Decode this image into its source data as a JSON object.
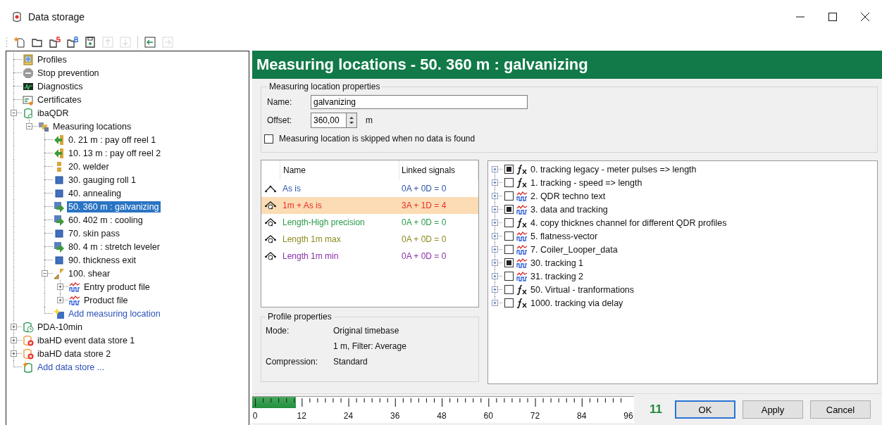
{
  "window": {
    "title": "Data storage"
  },
  "toolbar": [
    {
      "kind": "new",
      "disabled": false
    },
    {
      "kind": "open",
      "disabled": false
    },
    {
      "kind": "open-s",
      "disabled": false
    },
    {
      "kind": "open-b",
      "disabled": false
    },
    {
      "kind": "save",
      "disabled": false
    },
    {
      "kind": "up",
      "disabled": true
    },
    {
      "kind": "down",
      "disabled": true
    },
    {
      "kind": "back",
      "disabled": false
    },
    {
      "kind": "forward",
      "disabled": true
    }
  ],
  "tree": [
    {
      "label": "Profiles",
      "kind": "profiles",
      "selected": false
    },
    {
      "label": "Stop prevention",
      "kind": "stop",
      "selected": false
    },
    {
      "label": "Diagnostics",
      "kind": "diagnostics",
      "selected": false
    },
    {
      "label": "Certificates",
      "kind": "certificates",
      "selected": false
    },
    {
      "label": "ibaQDR",
      "kind": "store",
      "selected": false,
      "expanded": true,
      "children": [
        {
          "label": "Measuring locations",
          "kind": "locations",
          "selected": false,
          "expanded": true,
          "children": [
            {
              "label": "0. 21 m : pay off reel 1",
              "kind": "entry",
              "selected": false
            },
            {
              "label": "10. 13 m : pay off reel 2",
              "kind": "entry",
              "selected": false
            },
            {
              "label": "20. welder",
              "kind": "joint",
              "selected": false
            },
            {
              "label": "30. gauging roll 1",
              "kind": "station",
              "selected": false
            },
            {
              "label": "40. annealing",
              "kind": "station",
              "selected": false
            },
            {
              "label": "50. 360 m : galvanizing",
              "kind": "exit",
              "selected": true
            },
            {
              "label": "60. 402 m : cooling",
              "kind": "exit",
              "selected": false
            },
            {
              "label": "70. skin pass",
              "kind": "station",
              "selected": false
            },
            {
              "label": "80. 4 m : stretch leveler",
              "kind": "exit",
              "selected": false
            },
            {
              "label": "90. thickness exit",
              "kind": "station",
              "selected": false
            },
            {
              "label": "100. shear",
              "kind": "shear",
              "selected": false,
              "expanded": true,
              "children": [
                {
                  "label": "Entry product file",
                  "kind": "file",
                  "selected": false,
                  "expanded": false
                },
                {
                  "label": "Product file",
                  "kind": "file",
                  "selected": false,
                  "expanded": false
                }
              ]
            },
            {
              "label": "Add measuring location",
              "kind": "add",
              "selected": false,
              "link": true
            }
          ]
        }
      ]
    },
    {
      "label": "PDA-10min",
      "kind": "timed",
      "selected": false,
      "expanded": false
    },
    {
      "label": "ibaHD event data store 1",
      "kind": "failed",
      "selected": false,
      "expanded": false
    },
    {
      "label": "ibaHD data store 2",
      "kind": "failed",
      "selected": false,
      "expanded": false
    },
    {
      "label": "Add data store ...",
      "kind": "add-store",
      "selected": false,
      "link": true
    }
  ],
  "header": "Measuring locations - 50. 360 m : galvanizing",
  "location_properties": {
    "title": "Measuring location properties",
    "name_label": "Name:",
    "name_value": "galvanizing",
    "offset_label": "Offset:",
    "offset_value": "360,00",
    "offset_unit": "m",
    "skip_label": "Measuring location is skipped when no data is found",
    "skip_checked": false
  },
  "profiles": {
    "columns": [
      "Name",
      "Linked signals"
    ],
    "rows": [
      {
        "name": "As is",
        "linked": "0A + 0D = 0",
        "kind": "plain",
        "color": "#2f55a8",
        "selected": false
      },
      {
        "name": "1m + As is",
        "linked": "3A + 1D = 4",
        "kind": "q",
        "color": "#e8312b",
        "selected": true
      },
      {
        "name": "Length-High precision",
        "linked": "0A + 0D = 0",
        "kind": "q",
        "color": "#2b9a4a",
        "selected": false
      },
      {
        "name": "Length 1m max",
        "linked": "0A + 0D = 0",
        "kind": "q",
        "color": "#8f8a1e",
        "selected": false
      },
      {
        "name": "Length 1m min",
        "linked": "0A + 0D = 0",
        "kind": "q",
        "color": "#8a2fa8",
        "selected": false
      }
    ]
  },
  "profile_properties": {
    "title": "Profile properties",
    "rows": [
      {
        "label": "Mode:",
        "value": "Original timebase"
      },
      {
        "value": "1 m, Filter: Average"
      },
      {
        "label": "Compression:",
        "value": "Standard"
      }
    ]
  },
  "signals": [
    {
      "label": "0. tracking legacy - meter pulses => length",
      "kind": "fx",
      "checked": true,
      "expanded": false
    },
    {
      "label": "1. tracking - speed => length",
      "kind": "fx",
      "checked": false,
      "expanded": false
    },
    {
      "label": "2. QDR techno text",
      "kind": "signal",
      "checked": false,
      "expanded": false
    },
    {
      "label": "3. data and tracking",
      "kind": "signal",
      "checked": true,
      "expanded": false
    },
    {
      "label": "4. copy thicknes channel for different QDR profiles",
      "kind": "fx",
      "checked": false,
      "expanded": false
    },
    {
      "label": "5. flatness-vector",
      "kind": "signal",
      "checked": false,
      "expanded": false
    },
    {
      "label": "7. Coiler_Looper_data",
      "kind": "signal",
      "checked": false,
      "expanded": false
    },
    {
      "label": "30. tracking 1",
      "kind": "signal",
      "checked": true,
      "expanded": false
    },
    {
      "label": "31. tracking 2",
      "kind": "signal",
      "checked": false,
      "expanded": false
    },
    {
      "label": "50. Virtual - tranformations",
      "kind": "fx",
      "checked": false,
      "expanded": false
    },
    {
      "label": "1000. tracking via delay",
      "kind": "fx",
      "checked": false,
      "expanded": false
    }
  ],
  "meter": {
    "level": 0.115,
    "scale": [
      "0",
      "12",
      "24",
      "36",
      "48",
      "60",
      "72",
      "84",
      "96"
    ],
    "reading": "11"
  },
  "buttons": [
    {
      "label": "OK",
      "default": true
    },
    {
      "label": "Apply",
      "default": false
    },
    {
      "label": "Cancel",
      "default": false
    }
  ]
}
